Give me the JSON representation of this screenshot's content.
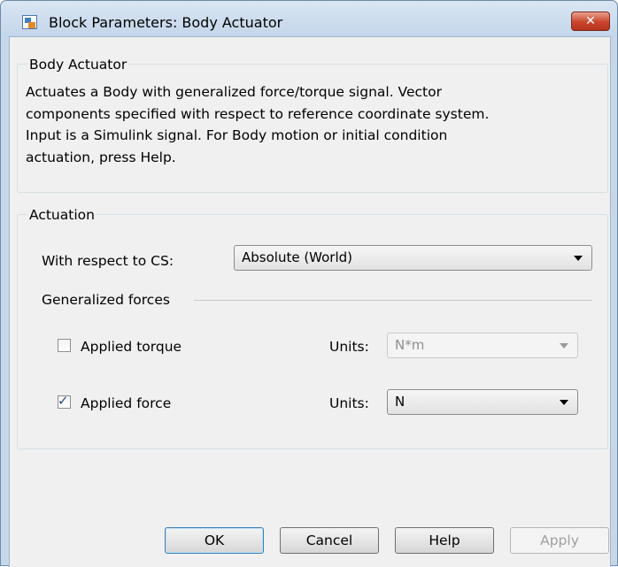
{
  "window": {
    "title": "Block Parameters: Body Actuator",
    "close_glyph": "✕"
  },
  "block_section": {
    "legend": "Body Actuator",
    "description": "Actuates a Body with generalized force/torque signal. Vector\ncomponents specified with respect to reference coordinate system.\nInput is a Simulink signal. For Body motion or initial condition\nactuation, press Help."
  },
  "actuation": {
    "legend": "Actuation",
    "cs_label": "With respect to CS:",
    "cs_value": "Absolute (World)",
    "generalized_forces_label": "Generalized forces",
    "applied_torque": {
      "label": "Applied torque",
      "checked": false,
      "enabled": true,
      "units_label": "Units:",
      "units_value": "N*m",
      "units_enabled": false
    },
    "applied_force": {
      "label": "Applied force",
      "checked": true,
      "enabled": true,
      "units_label": "Units:",
      "units_value": "N",
      "units_enabled": true
    }
  },
  "buttons": {
    "ok": "OK",
    "cancel": "Cancel",
    "help": "Help",
    "apply": "Apply",
    "apply_enabled": false
  },
  "icons": {
    "app": "simulink-block-icon",
    "close": "close-icon",
    "dropdown": "chevron-down-icon",
    "check": "check-icon"
  },
  "colors": {
    "title_bar": "#c6d7ea",
    "close_button": "#c9452d",
    "dialog_bg": "#f0f0f0",
    "default_button_border": "#3c7fb1"
  }
}
